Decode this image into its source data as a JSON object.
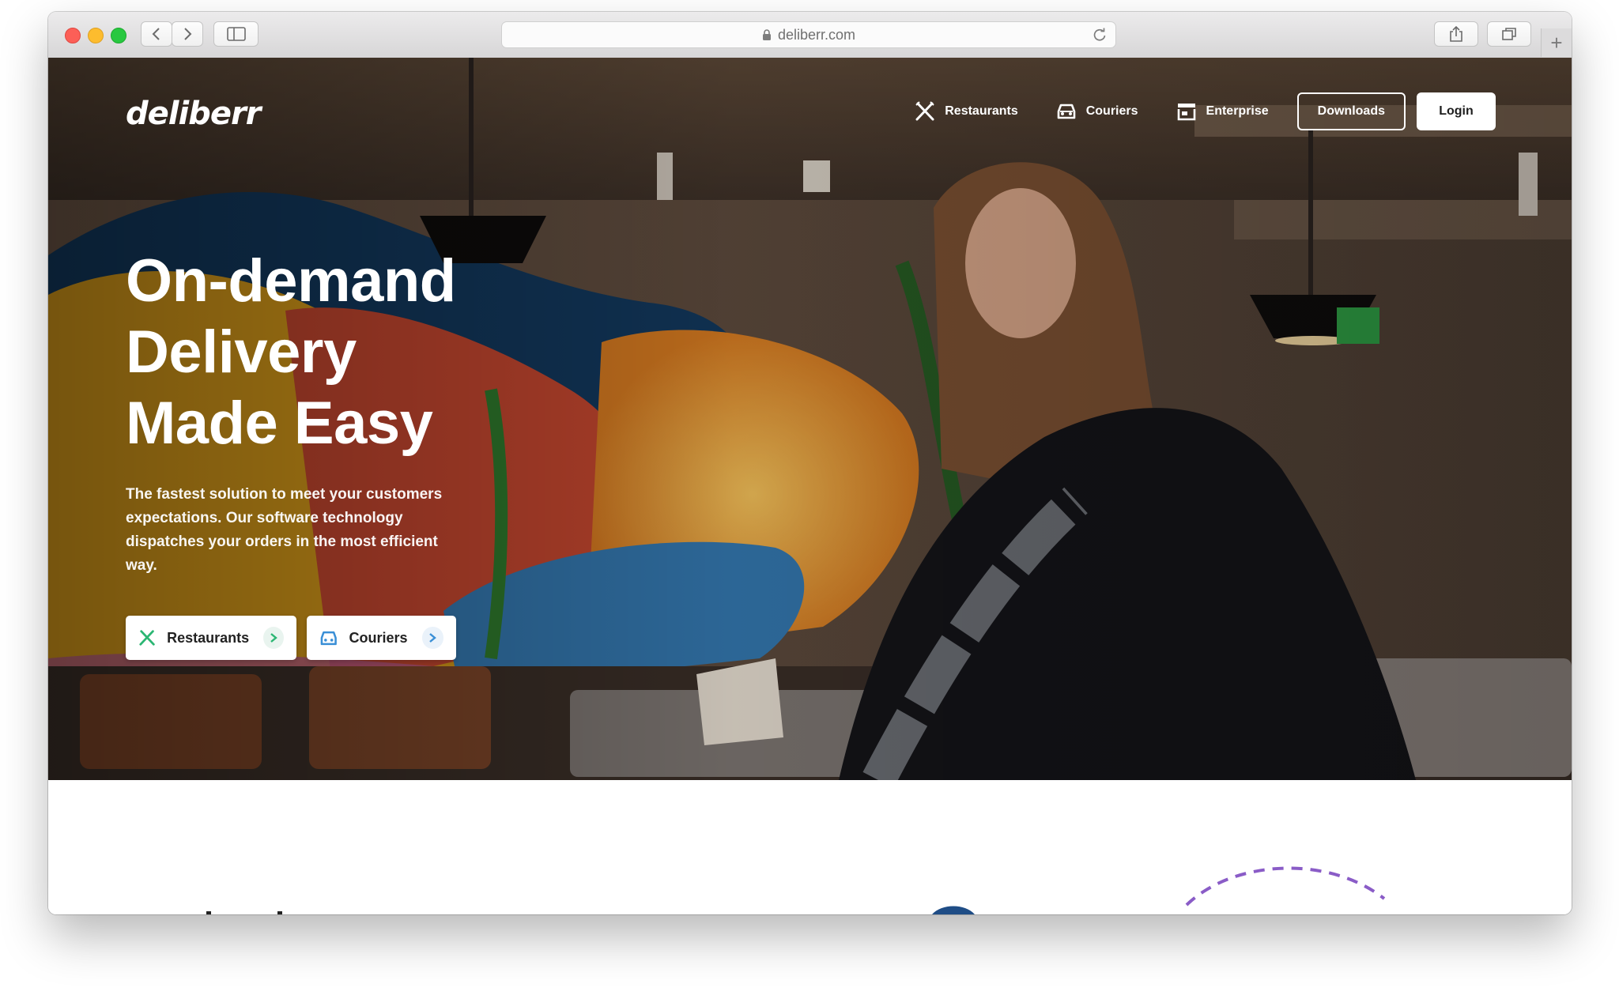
{
  "browser": {
    "url": "deliberr.com",
    "new_tab_glyph": "+"
  },
  "site": {
    "logo_text": "deliberr",
    "nav": {
      "restaurants": "Restaurants",
      "couriers": "Couriers",
      "enterprise": "Enterprise",
      "downloads": "Downloads",
      "login": "Login"
    },
    "hero": {
      "title_line1": "On-demand",
      "title_line2": "Delivery",
      "title_line3": "Made Easy",
      "subtitle": "The fastest solution to meet your customers expectations. Our software technology dispatches your orders in the most efficient way.",
      "cta_restaurants": "Restaurants",
      "cta_couriers": "Couriers"
    },
    "icons": {
      "restaurants": "fork-knife-icon",
      "couriers": "car-icon",
      "enterprise": "store-icon",
      "chevron": "chevron-right-icon"
    },
    "colors": {
      "cta_green": "#2bb673",
      "cta_blue": "#3a8fd6",
      "accent_purple": "#8a5cc7"
    }
  }
}
